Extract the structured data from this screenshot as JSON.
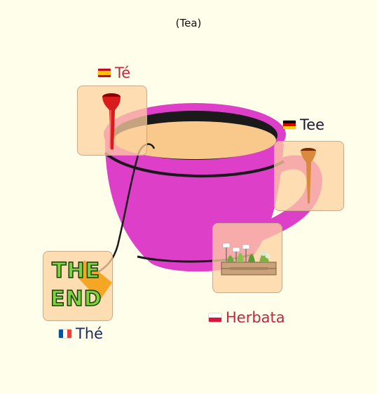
{
  "title": "(Tea)",
  "languages": {
    "spanish": {
      "word": "Té",
      "flag_icon": "spain-flag-icon"
    },
    "german": {
      "word": "Tee",
      "flag_icon": "germany-flag-icon"
    },
    "french": {
      "word": "Thé",
      "flag_icon": "france-flag-icon"
    },
    "polish": {
      "word": "Herbata",
      "flag_icon": "poland-flag-icon"
    }
  },
  "the_end": {
    "line1": "THE",
    "line2": "END"
  },
  "colors": {
    "background": "#fffeea",
    "cup": "#dd3fc9",
    "tea": "#f8c98a",
    "label_red": "#c0283c",
    "label_dark": "#1a1a2e"
  }
}
